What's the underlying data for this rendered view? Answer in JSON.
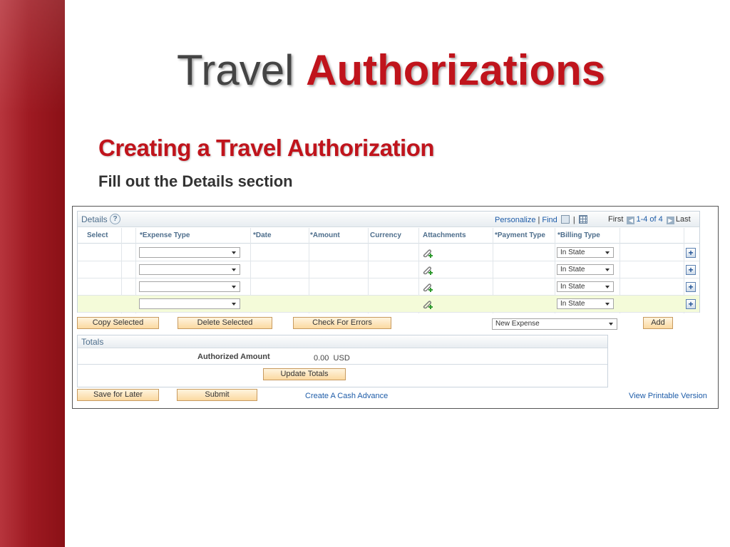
{
  "slide": {
    "title_part1": "Travel",
    "title_part2": "Authorizations",
    "subtitle": "Creating a Travel Authorization",
    "note": "Fill out the Details section"
  },
  "details": {
    "title": "Details",
    "help": "?",
    "personalize": "Personalize",
    "find": "Find",
    "sep": "|",
    "first": "First",
    "range": "1-4 of 4",
    "last": "Last",
    "columns": {
      "select": "Select",
      "expense_type": "*Expense Type",
      "date": "*Date",
      "amount": "*Amount",
      "currency": "Currency",
      "attachments": "Attachments",
      "payment_type": "*Payment Type",
      "billing_type": "*Billing Type"
    },
    "rows": [
      {
        "billing_type": "In State"
      },
      {
        "billing_type": "In State"
      },
      {
        "billing_type": "In State"
      },
      {
        "billing_type": "In State"
      }
    ]
  },
  "actions": {
    "copy_selected": "Copy Selected",
    "delete_selected": "Delete Selected",
    "check_errors": "Check For Errors",
    "new_expense": "New Expense",
    "add": "Add"
  },
  "totals": {
    "title": "Totals",
    "authorized_amount_label": "Authorized Amount",
    "authorized_amount_value": "0.00",
    "currency": "USD",
    "update_totals": "Update Totals"
  },
  "footer": {
    "save_for_later": "Save for Later",
    "submit": "Submit",
    "cash_advance": "Create A Cash Advance",
    "printable": "View Printable Version"
  },
  "colors": {
    "accent_red": "#c0141c",
    "link_blue": "#1e5ca8",
    "header_blue": "#4e6e8c",
    "button_fill": "#fbd9a1",
    "highlight_row": "#f4fbd9"
  }
}
